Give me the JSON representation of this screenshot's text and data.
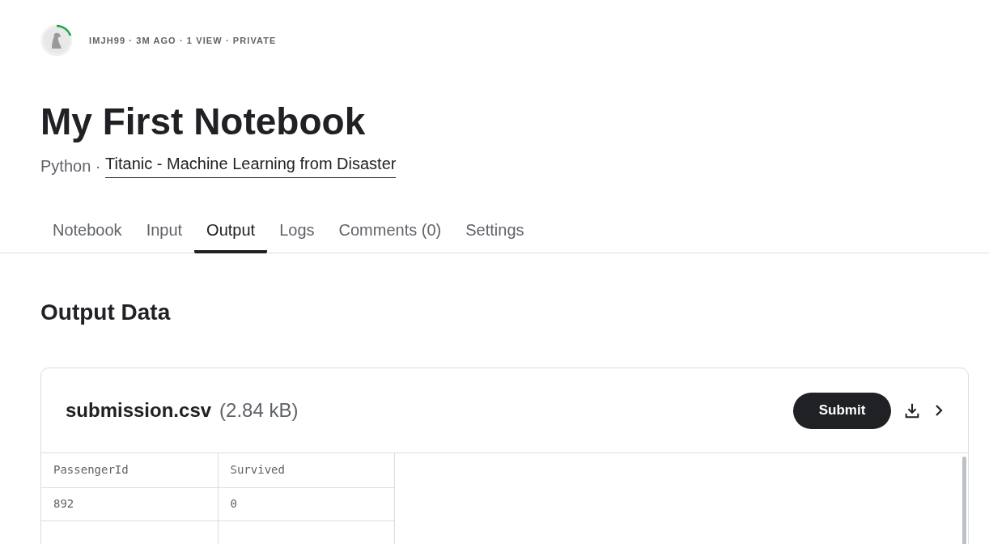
{
  "meta": "IMJH99 · 3M AGO · 1 VIEW · PRIVATE",
  "title": "My First Notebook",
  "subtitle": {
    "language": "Python · ",
    "competition": "Titanic - Machine Learning from Disaster"
  },
  "tabs": [
    {
      "label": "Notebook",
      "selected": false
    },
    {
      "label": "Input",
      "selected": false
    },
    {
      "label": "Output",
      "selected": true
    },
    {
      "label": "Logs",
      "selected": false
    },
    {
      "label": "Comments (0)",
      "selected": false
    },
    {
      "label": "Settings",
      "selected": false
    }
  ],
  "section_title": "Output Data",
  "file": {
    "name": "submission.csv",
    "size": "(2.84 kB)",
    "submit_label": "Submit"
  },
  "table": {
    "columns": [
      "PassengerId",
      "Survived"
    ],
    "rows": [
      [
        "892",
        "0"
      ]
    ]
  }
}
